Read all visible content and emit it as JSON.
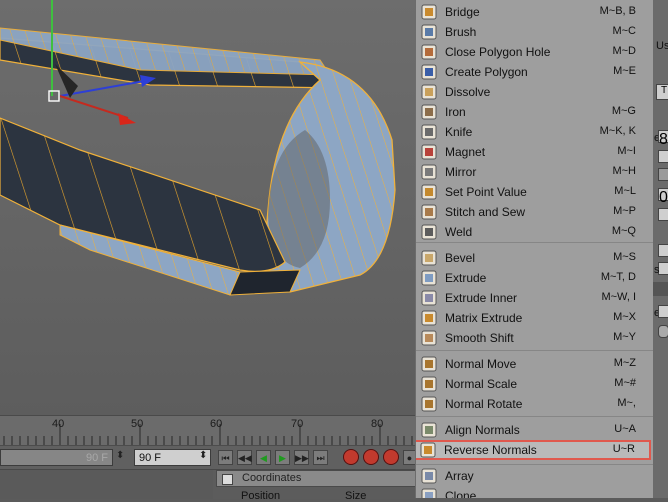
{
  "timeline": {
    "ticks": [
      "40",
      "50",
      "60",
      "70",
      "80"
    ]
  },
  "transport": {
    "end_frame_dim": "90 F",
    "end_frame": "90 F"
  },
  "attributes": {
    "tab": "Coordinates",
    "col_position": "Position",
    "col_size": "Size"
  },
  "right_panel": {
    "items": [
      "Us",
      "T",
      "e",
      "8",
      "",
      "",
      "0",
      "",
      "",
      "s",
      "e"
    ]
  },
  "menu": {
    "highlight_color": "#e0584d",
    "items": [
      {
        "label": "Bridge",
        "shortcut": "M~B, B",
        "icon": "bridge-icon"
      },
      {
        "label": "Brush",
        "shortcut": "M~C",
        "icon": "brush-icon"
      },
      {
        "label": "Close Polygon Hole",
        "shortcut": "M~D",
        "icon": "close-polygon-hole-icon"
      },
      {
        "label": "Create Polygon",
        "shortcut": "M~E",
        "icon": "create-polygon-icon"
      },
      {
        "label": "Dissolve",
        "shortcut": "",
        "icon": "dissolve-icon"
      },
      {
        "label": "Iron",
        "shortcut": "M~G",
        "icon": "iron-icon"
      },
      {
        "label": "Knife",
        "shortcut": "M~K, K",
        "icon": "knife-icon"
      },
      {
        "label": "Magnet",
        "shortcut": "M~I",
        "icon": "magnet-icon"
      },
      {
        "label": "Mirror",
        "shortcut": "M~H",
        "icon": "mirror-icon"
      },
      {
        "label": "Set Point Value",
        "shortcut": "M~L",
        "icon": "set-point-value-icon"
      },
      {
        "label": "Stitch and Sew",
        "shortcut": "M~P",
        "icon": "stitch-and-sew-icon"
      },
      {
        "label": "Weld",
        "shortcut": "M~Q",
        "icon": "weld-icon"
      },
      {
        "label": "Bevel",
        "shortcut": "M~S",
        "icon": "bevel-icon"
      },
      {
        "label": "Extrude",
        "shortcut": "M~T, D",
        "icon": "extrude-icon"
      },
      {
        "label": "Extrude Inner",
        "shortcut": "M~W, I",
        "icon": "extrude-inner-icon"
      },
      {
        "label": "Matrix Extrude",
        "shortcut": "M~X",
        "icon": "matrix-extrude-icon"
      },
      {
        "label": "Smooth Shift",
        "shortcut": "M~Y",
        "icon": "smooth-shift-icon"
      },
      {
        "label": "Normal Move",
        "shortcut": "M~Z",
        "icon": "normal-move-icon"
      },
      {
        "label": "Normal Scale",
        "shortcut": "M~#",
        "icon": "normal-scale-icon"
      },
      {
        "label": "Normal Rotate",
        "shortcut": "M~,",
        "icon": "normal-rotate-icon"
      },
      {
        "label": "Align Normals",
        "shortcut": "U~A",
        "icon": "align-normals-icon"
      },
      {
        "label": "Reverse Normals",
        "shortcut": "U~R",
        "icon": "reverse-normals-icon",
        "highlighted": true
      },
      {
        "label": "Array",
        "shortcut": "",
        "icon": "array-icon"
      },
      {
        "label": "Clone",
        "shortcut": "",
        "icon": "clone-icon"
      }
    ]
  }
}
